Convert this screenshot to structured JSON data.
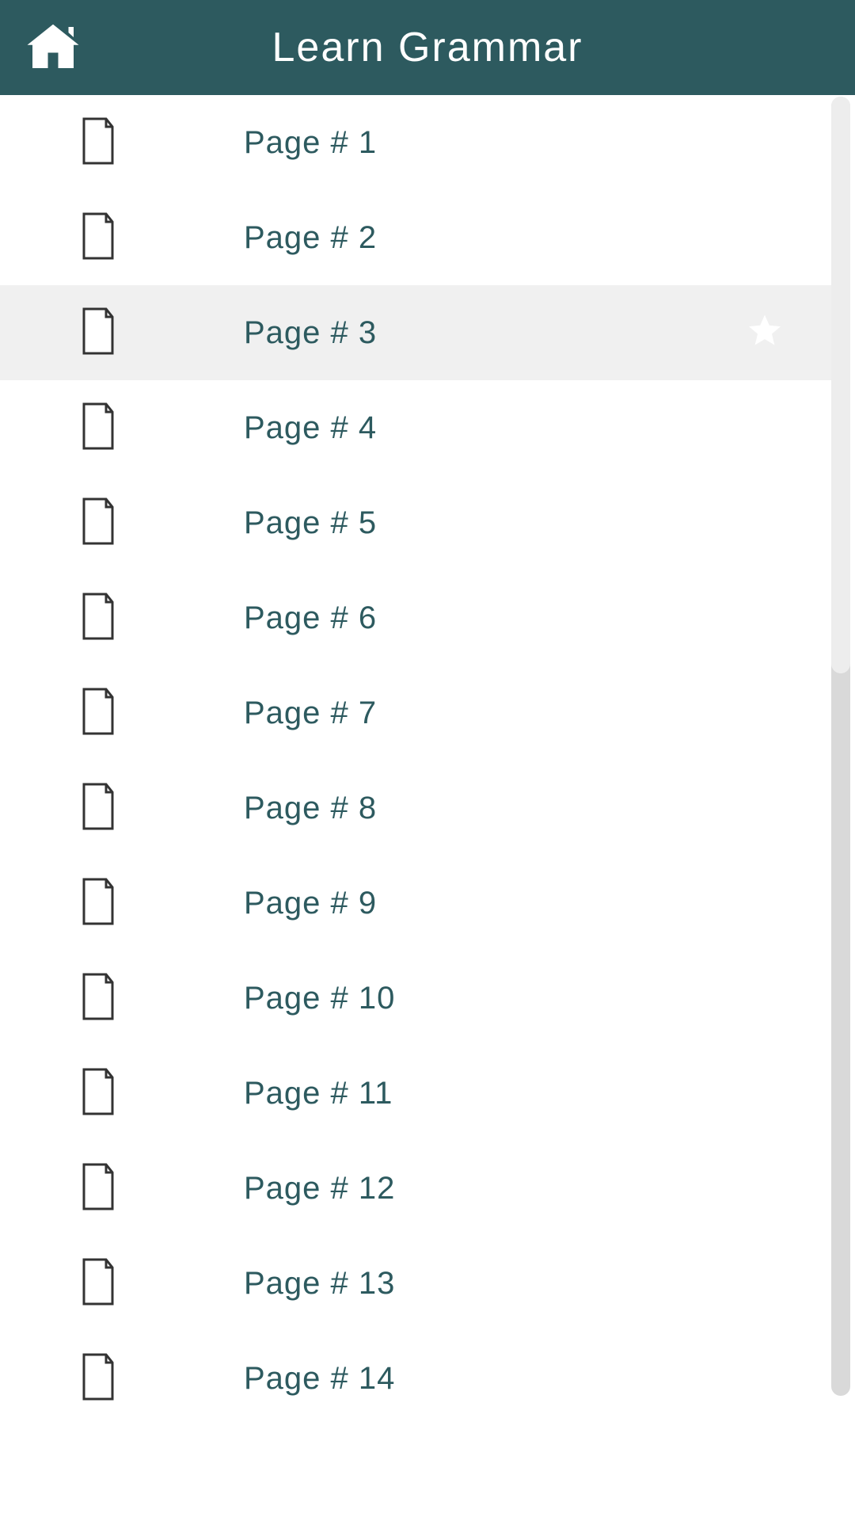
{
  "header": {
    "title": "Learn Grammar"
  },
  "pages": [
    {
      "label": "Page # 1",
      "selected": false
    },
    {
      "label": "Page # 2",
      "selected": false
    },
    {
      "label": "Page # 3",
      "selected": true
    },
    {
      "label": "Page # 4",
      "selected": false
    },
    {
      "label": "Page # 5",
      "selected": false
    },
    {
      "label": "Page # 6",
      "selected": false
    },
    {
      "label": "Page # 7",
      "selected": false
    },
    {
      "label": "Page # 8",
      "selected": false
    },
    {
      "label": "Page # 9",
      "selected": false
    },
    {
      "label": "Page # 10",
      "selected": false
    },
    {
      "label": "Page # 11",
      "selected": false
    },
    {
      "label": "Page # 12",
      "selected": false
    },
    {
      "label": "Page # 13",
      "selected": false
    },
    {
      "label": "Page # 14",
      "selected": false
    }
  ],
  "colors": {
    "header_bg": "#2d5a5f",
    "text": "#2d5a5f",
    "selected_bg": "#f0f0f0",
    "icon_stroke": "#333333"
  }
}
